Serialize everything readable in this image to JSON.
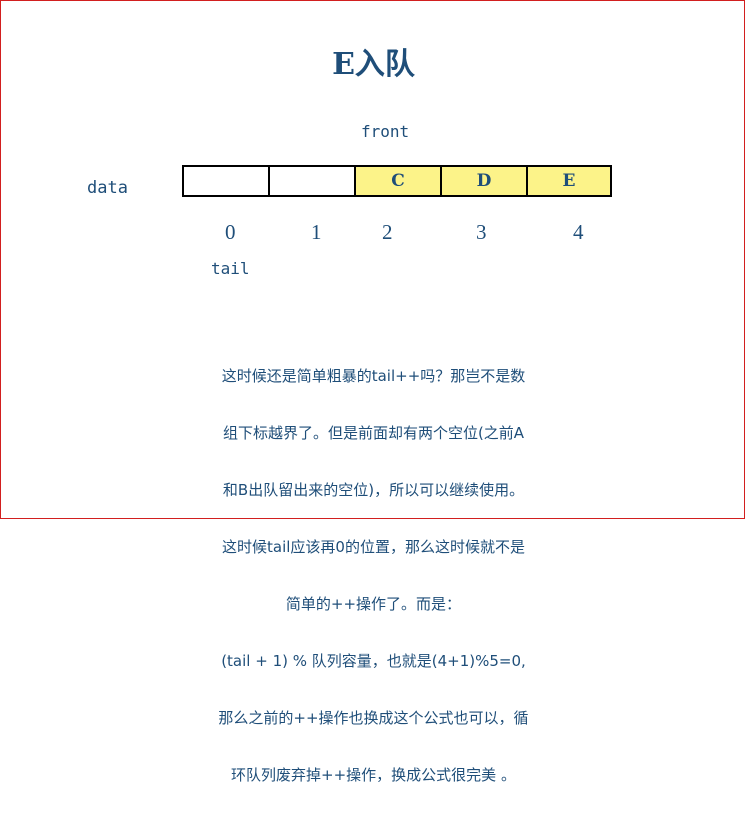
{
  "title": "E入队",
  "front_label": "front",
  "data_label": "data",
  "tail_label": "tail",
  "cells": [
    "",
    "",
    "C",
    "D",
    "E"
  ],
  "indices": [
    "0",
    "1",
    "2",
    "3",
    "4"
  ],
  "caption_lines": [
    "这时候还是简单粗暴的tail++吗？那岂不是数",
    "组下标越界了。但是前面却有两个空位(之前A",
    "和B出队留出来的空位)，所以可以继续使用。",
    "这时候tail应该再0的位置，那么这时候就不是",
    "简单的++操作了。而是：",
    "(tail + 1) % 队列容量，也就是(4+1)%5=0,",
    "那么之前的++操作也换成这个公式也可以，循",
    "环队列废弃掉++操作，换成公式很完美 。"
  ],
  "colors": {
    "text": "#1f4e79",
    "filled_cell": "#fcf389",
    "border": "#d21f1f"
  }
}
